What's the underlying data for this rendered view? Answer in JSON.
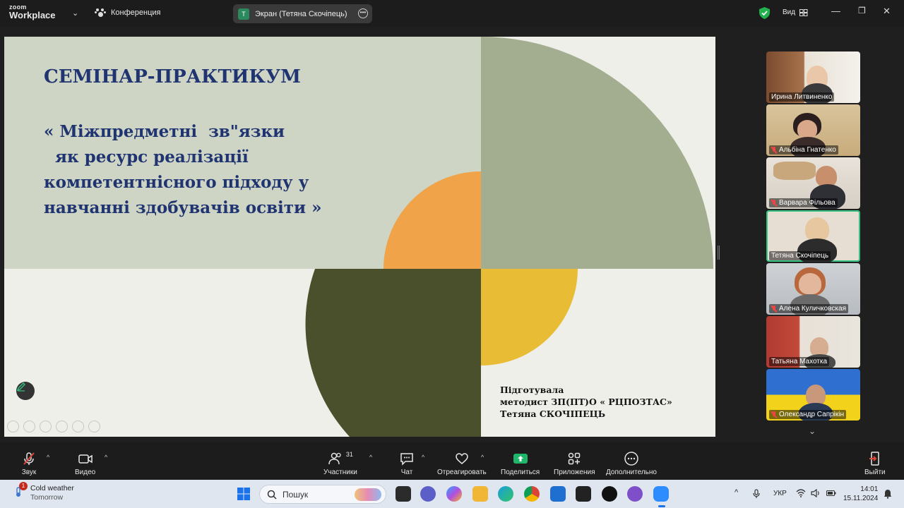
{
  "app": {
    "logo_line1": "zoom",
    "logo_line2": "Workplace",
    "conference_label": "Конференция",
    "screen_share_avatar": "T",
    "screen_share_label": "Экран (Тетяна Скочіпець)",
    "view_label": "Вид"
  },
  "slide": {
    "heading": "СЕМІНАР-ПРАКТИКУМ",
    "title": "« Міжпредметні  зв\"язки\n  як ресурс реалізації\nкомпетентнісного підходу у\nнавчанні здобувачів освіти »",
    "author_line1": "Підготувала",
    "author_line2": "методист ЗП(ПТ)О « РЦПОЗТАС»",
    "author_line3": "Тетяна СКОЧІПЕЦЬ",
    "colors": {
      "top_band": "#cfd5c5",
      "quarter_green": "#a2ae8f",
      "orange": "#f0a348",
      "dark_olive": "#4a4f2c",
      "yellow": "#e9bc36",
      "text": "#1f3470"
    }
  },
  "participants": [
    {
      "name": "Ирина Литвиненко",
      "muted": false,
      "active": false
    },
    {
      "name": "Альбіна Гнатенко",
      "muted": true,
      "active": false
    },
    {
      "name": "Варвара Фільова",
      "muted": true,
      "active": false
    },
    {
      "name": "Тетяна Скочіпець",
      "muted": false,
      "active": true
    },
    {
      "name": "Алена Куличковская",
      "muted": true,
      "active": false
    },
    {
      "name": "Татьяна Махотка",
      "muted": false,
      "active": false
    },
    {
      "name": "Олександр Сапрікін",
      "muted": true,
      "active": false
    }
  ],
  "toolbar": {
    "audio": "Звук",
    "video": "Видео",
    "participants": "Участники",
    "participants_count": "31",
    "chat": "Чат",
    "react": "Отреагировать",
    "share": "Поделиться",
    "apps": "Приложения",
    "more": "Дополнительно",
    "leave": "Выйти"
  },
  "taskbar": {
    "weather_title": "Cold weather",
    "weather_sub": "Tomorrow",
    "weather_badge": "1",
    "search_placeholder": "Пошук",
    "language": "УКР",
    "time": "14:01",
    "date": "15.11.2024"
  }
}
